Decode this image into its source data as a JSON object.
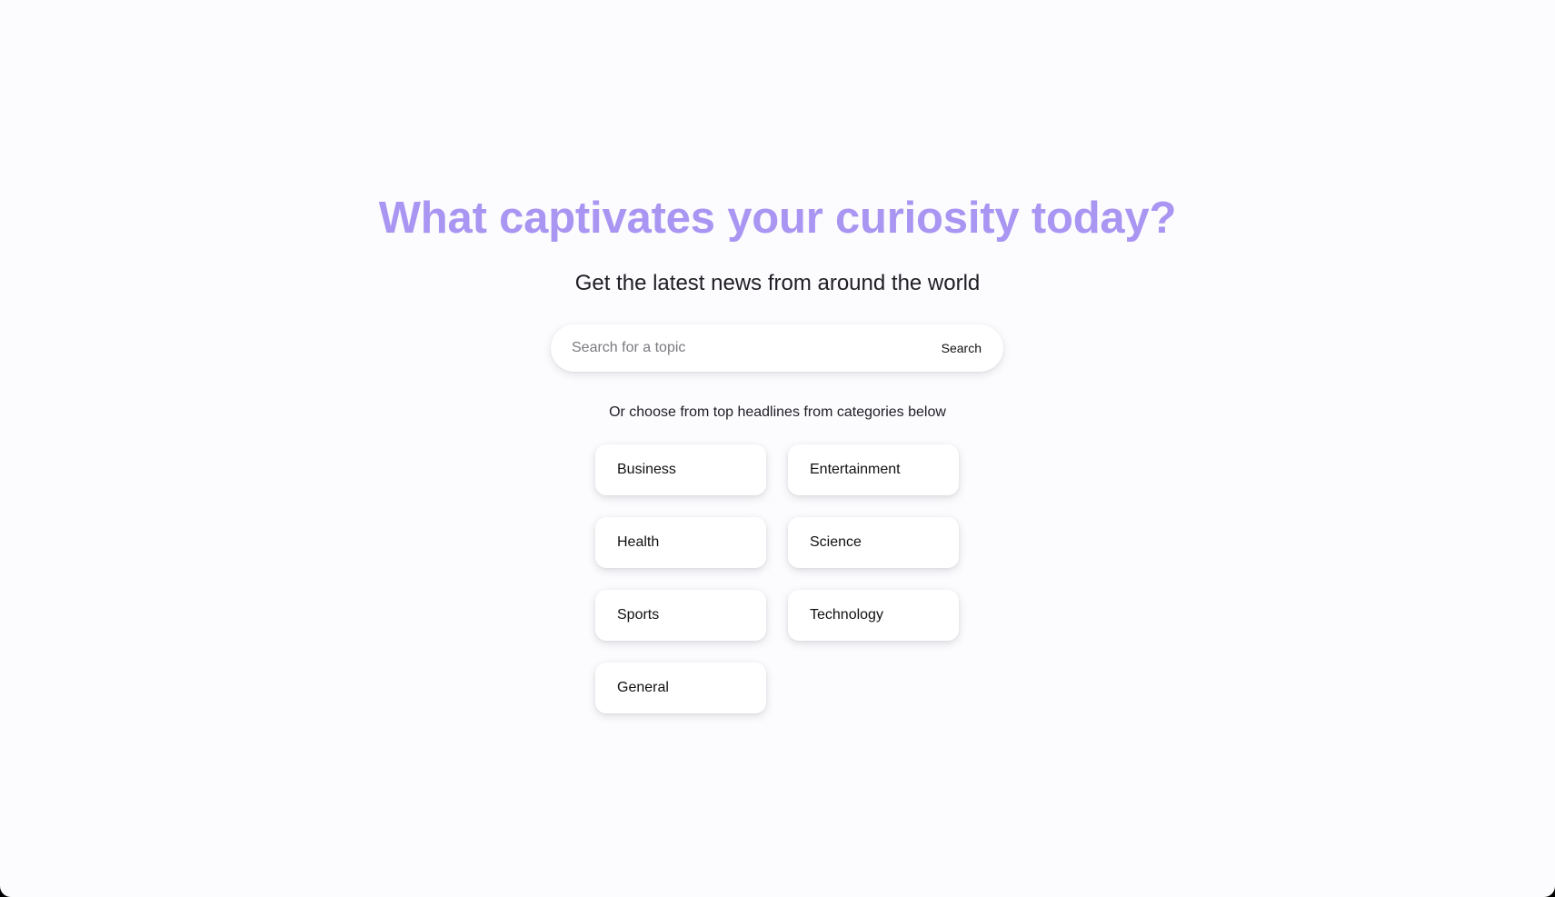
{
  "hero": {
    "headline": "What captivates your curiosity today?",
    "subline": "Get the latest news from around the world"
  },
  "search": {
    "placeholder": "Search for a topic",
    "value": "",
    "button_label": "Search"
  },
  "categories": {
    "hint": "Or choose from top headlines from categories below",
    "items": [
      {
        "label": "Business"
      },
      {
        "label": "Entertainment"
      },
      {
        "label": "Health"
      },
      {
        "label": "Science"
      },
      {
        "label": "Sports"
      },
      {
        "label": "Technology"
      },
      {
        "label": "General"
      }
    ]
  },
  "colors": {
    "accent": "#a995f2",
    "background": "#fcfcfe",
    "text": "#1e1e24"
  }
}
